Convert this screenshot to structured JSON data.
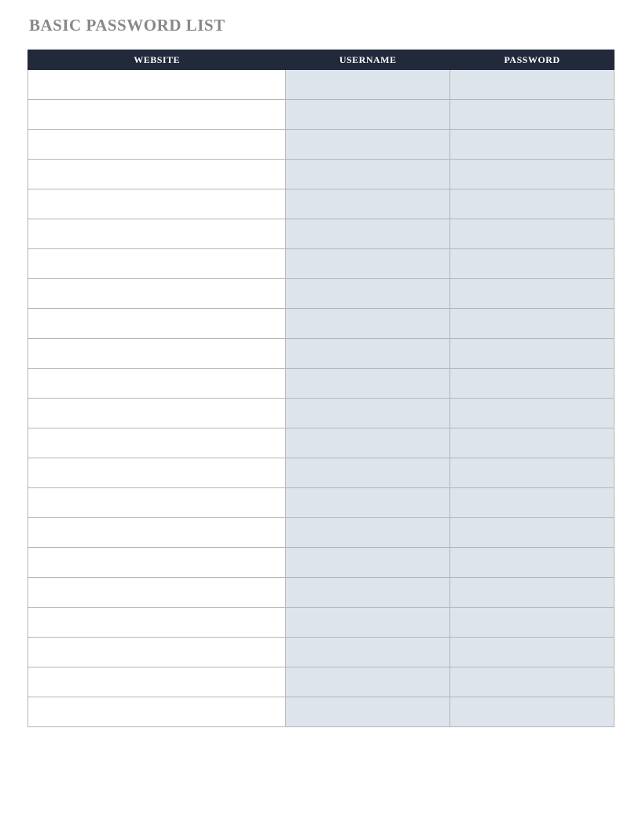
{
  "title": "BASIC PASSWORD LIST",
  "table": {
    "columns": {
      "website": "WEBSITE",
      "username": "USERNAME",
      "password": "PASSWORD"
    },
    "rows": [
      {
        "website": "",
        "username": "",
        "password": ""
      },
      {
        "website": "",
        "username": "",
        "password": ""
      },
      {
        "website": "",
        "username": "",
        "password": ""
      },
      {
        "website": "",
        "username": "",
        "password": ""
      },
      {
        "website": "",
        "username": "",
        "password": ""
      },
      {
        "website": "",
        "username": "",
        "password": ""
      },
      {
        "website": "",
        "username": "",
        "password": ""
      },
      {
        "website": "",
        "username": "",
        "password": ""
      },
      {
        "website": "",
        "username": "",
        "password": ""
      },
      {
        "website": "",
        "username": "",
        "password": ""
      },
      {
        "website": "",
        "username": "",
        "password": ""
      },
      {
        "website": "",
        "username": "",
        "password": ""
      },
      {
        "website": "",
        "username": "",
        "password": ""
      },
      {
        "website": "",
        "username": "",
        "password": ""
      },
      {
        "website": "",
        "username": "",
        "password": ""
      },
      {
        "website": "",
        "username": "",
        "password": ""
      },
      {
        "website": "",
        "username": "",
        "password": ""
      },
      {
        "website": "",
        "username": "",
        "password": ""
      },
      {
        "website": "",
        "username": "",
        "password": ""
      },
      {
        "website": "",
        "username": "",
        "password": ""
      },
      {
        "website": "",
        "username": "",
        "password": ""
      },
      {
        "website": "",
        "username": "",
        "password": ""
      }
    ]
  },
  "colors": {
    "title_text": "#888888",
    "header_bg": "#22293a",
    "header_text": "#ffffff",
    "cell_border": "#b5b5b5",
    "website_bg": "#ffffff",
    "shaded_bg": "#dee4ec"
  }
}
